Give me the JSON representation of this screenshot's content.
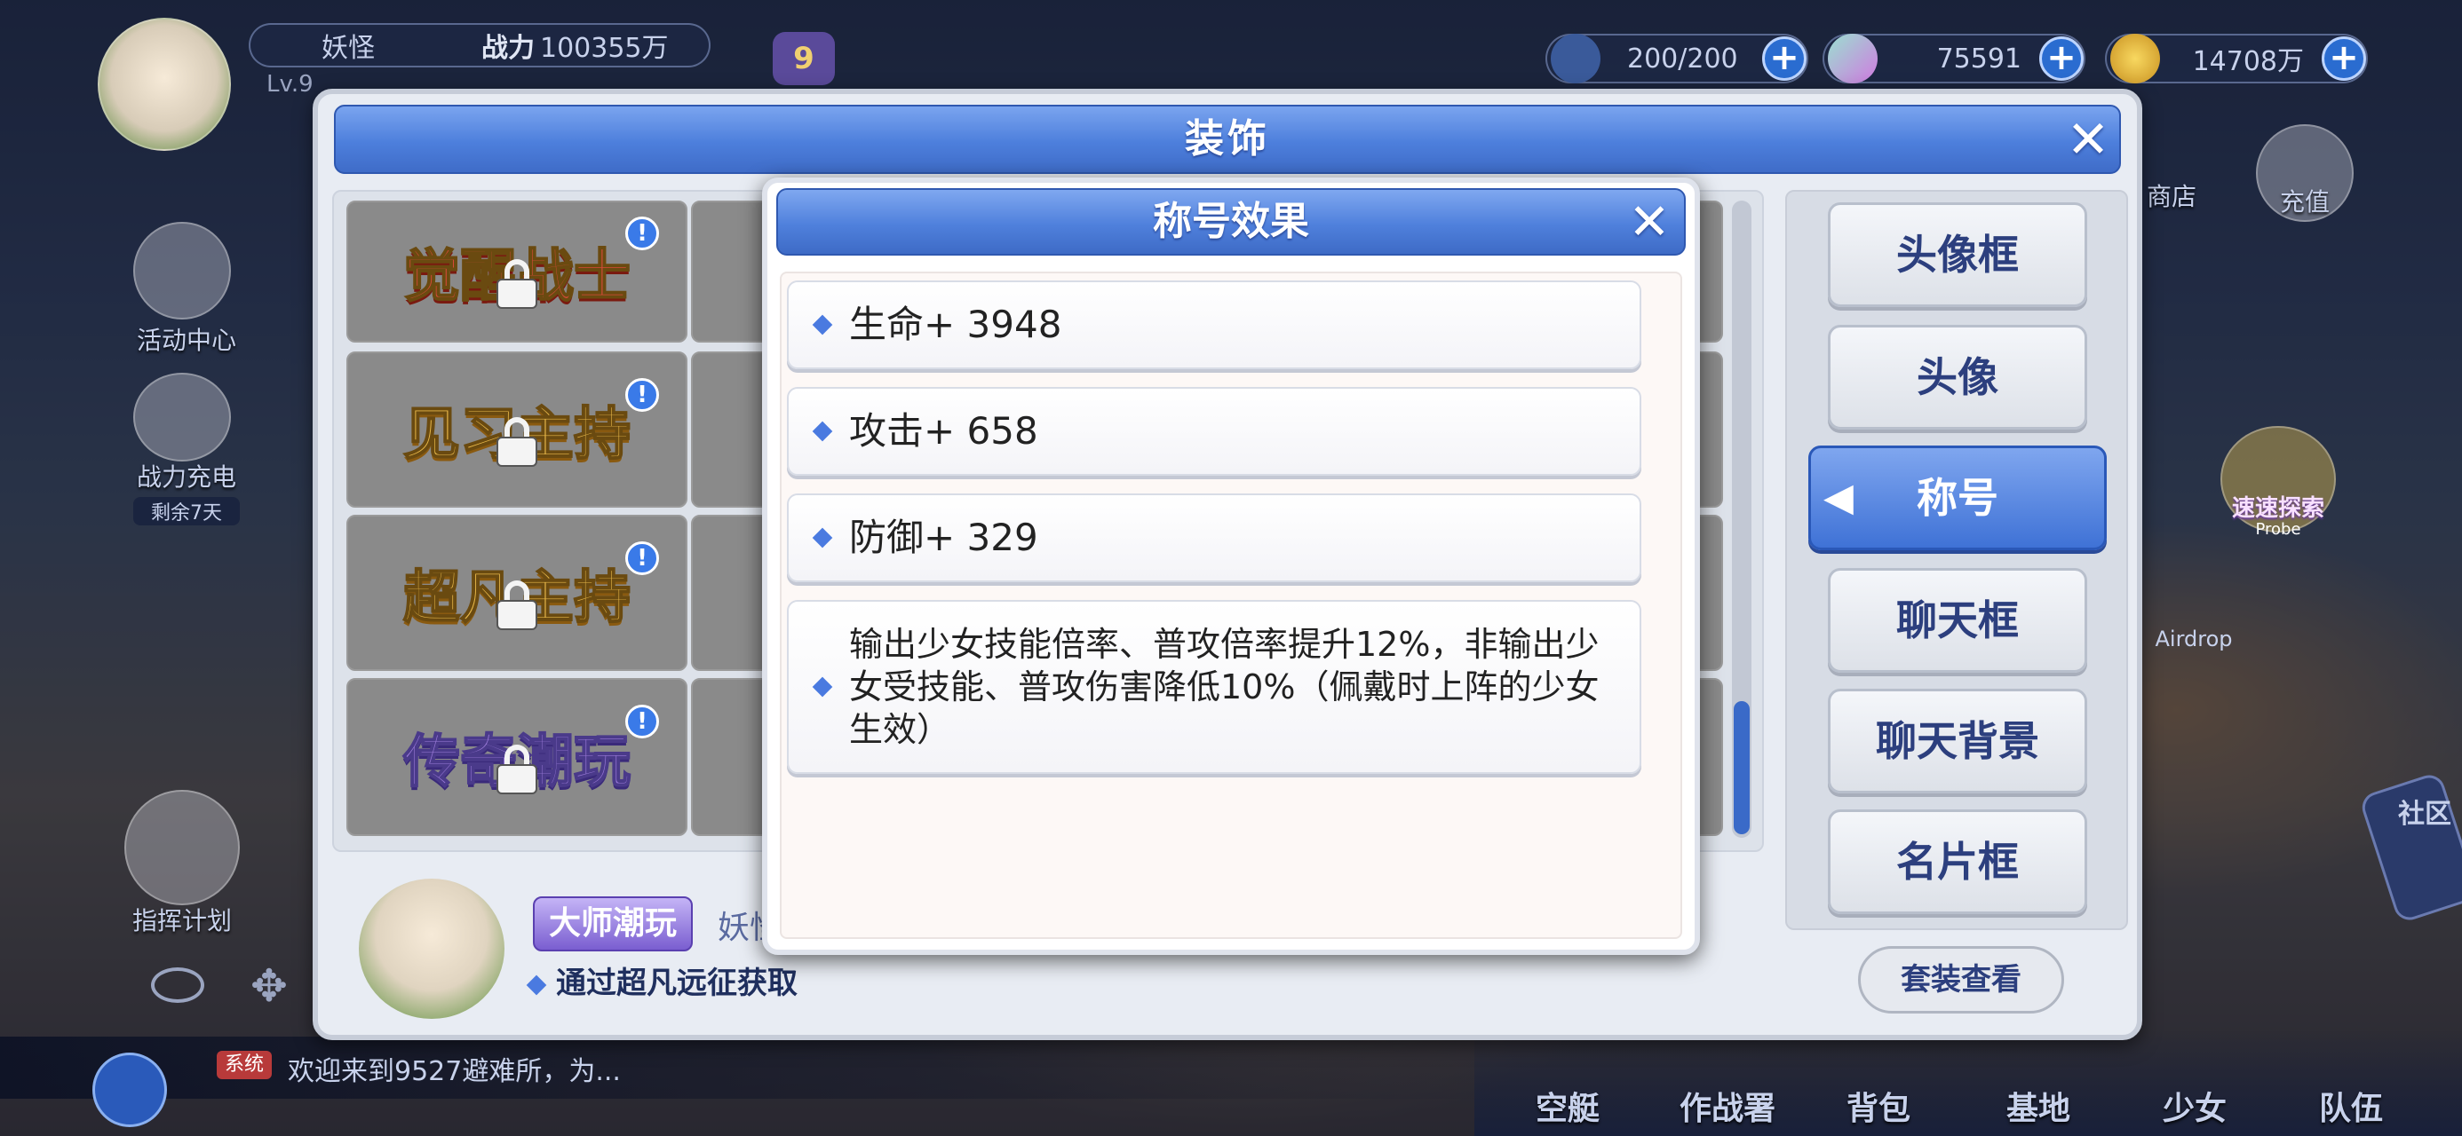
{
  "hud": {
    "player_name": "妖怪",
    "power_label": "战力",
    "power_value": "100355万",
    "level": "Lv.9",
    "vip_level": "9",
    "stamina": "200/200",
    "gems": "75591",
    "gold": "14708万"
  },
  "left_menu": {
    "activity_center": "活动中心",
    "power_recharge": "战力充电",
    "remaining": "剩余7天",
    "command_plan": "指挥计划"
  },
  "right_menu": {
    "shop": "商店",
    "recharge": "充值",
    "probe": "速速探索",
    "probe_sub": "Probe",
    "airdrop": "Airdrop",
    "community": "社区"
  },
  "chat": {
    "tag": "系统",
    "message": "欢迎来到9527避难所，为..."
  },
  "bottom_nav": [
    "空艇",
    "作战署",
    "背包",
    "基地",
    "少女",
    "队伍"
  ],
  "decoration_dialog": {
    "title": "装饰",
    "close": "✕",
    "titles_grid": [
      {
        "text": "觉醒战士",
        "style": "red"
      },
      {
        "text": "见习主持",
        "style": "gold"
      },
      {
        "text": "超凡主持",
        "style": "gold"
      },
      {
        "text": "传奇潮玩",
        "style": "purple"
      }
    ],
    "tabs": [
      "头像框",
      "头像",
      "称号",
      "聊天框",
      "聊天背景",
      "名片框"
    ],
    "active_tab": "称号",
    "set_view_button": "套装查看",
    "selected_badge": "大师潮玩",
    "owner_name": "妖怪",
    "obtain_text": "通过超凡远征获取"
  },
  "effect_popup": {
    "title": "称号效果",
    "close": "✕",
    "effects": [
      "生命+ 3948",
      "攻击+ 658",
      "防御+ 329",
      "输出少女技能倍率、普攻倍率提升12%，非输出少女受技能、普攻伤害降低10%（佩戴时上阵的少女生效）"
    ]
  },
  "colors": {
    "title_bar": "#4d7fdc",
    "tab_text": "#2c3f7e",
    "active_tab": "#3f72d6",
    "diamond": "#4a7ae0"
  }
}
